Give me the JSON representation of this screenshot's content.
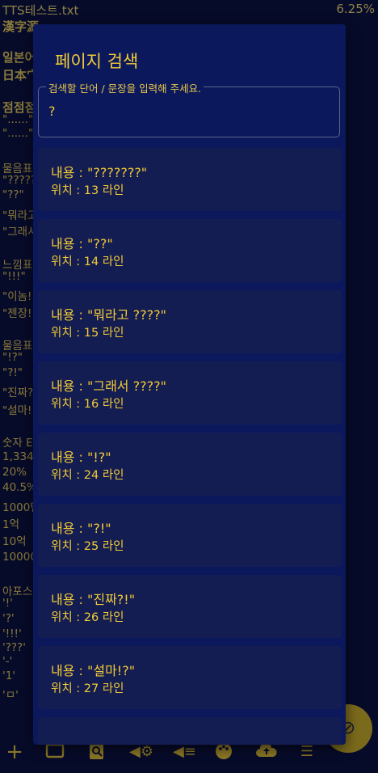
{
  "status_bar": {
    "file_name": "TTS테스트.txt",
    "progress": "6.25%"
  },
  "background_lines": [
    {
      "text": "漢字源",
      "bold": true
    },
    {
      "text": "일본어",
      "bold": true
    },
    {
      "text": "日本宀",
      "bold": true
    },
    {
      "text": "점점점",
      "bold": true
    },
    {
      "text": "\"......\""
    },
    {
      "text": "\"......\""
    },
    {
      "text": "물음표"
    },
    {
      "text": "\"?????"
    },
    {
      "text": "\"??\""
    },
    {
      "text": "\"뭐라고"
    },
    {
      "text": "\"그래서"
    },
    {
      "text": "느낌표"
    },
    {
      "text": "\"!!!\""
    },
    {
      "text": "\"이놈!"
    },
    {
      "text": "\"젠장!"
    },
    {
      "text": "물음표"
    },
    {
      "text": "\"!?\""
    },
    {
      "text": "\"?!\""
    },
    {
      "text": "\"진짜?"
    },
    {
      "text": "\"설마!"
    },
    {
      "text": "숫자 E"
    },
    {
      "text": "1,334"
    },
    {
      "text": "20%"
    },
    {
      "text": "40.5%"
    },
    {
      "text": "1000만"
    },
    {
      "text": "1억"
    },
    {
      "text": "10억"
    },
    {
      "text": "10000"
    },
    {
      "text": "아포스"
    },
    {
      "text": "'!'"
    },
    {
      "text": "'?'"
    },
    {
      "text": "'!!!'"
    },
    {
      "text": "'???'"
    },
    {
      "text": "'-'"
    },
    {
      "text": "'1'"
    },
    {
      "text": "'ㅁ'"
    }
  ],
  "dialog": {
    "title": "페이지 검색",
    "search_label": "검색할 단어 / 문장을 입력해 주세요.",
    "search_value": "?",
    "results": [
      {
        "content": "내용 : \"???????\"",
        "location": "위치 : 13 라인"
      },
      {
        "content": "내용 : \"??\"",
        "location": "위치 : 14 라인"
      },
      {
        "content": "내용 : \"뭐라고 ????\"",
        "location": "위치 : 15 라인"
      },
      {
        "content": "내용 : \"그래서 ????\"",
        "location": "위치 : 16 라인"
      },
      {
        "content": "내용 : \"!?\"",
        "location": "위치 : 24 라인"
      },
      {
        "content": "내용 : \"?!\"",
        "location": "위치 : 25 라인"
      },
      {
        "content": "내용 : \"진짜?!\"",
        "location": "위치 : 26 라인"
      },
      {
        "content": "내용 : \"설마!?\"",
        "location": "위치 : 27 라인"
      },
      {
        "content": "",
        "location": ""
      }
    ]
  },
  "toolbar": {
    "icons": [
      "add-icon",
      "folder-icon",
      "page-search-icon",
      "speaker-settings-icon",
      "speaker-filter-icon",
      "palette-icon",
      "cloud-upload-icon",
      "list-icon"
    ],
    "fab_icon": "tts-off-icon"
  },
  "colors": {
    "accent": "#f2cb36",
    "dialog_bg": "#0b185c",
    "card_bg": "#141d52",
    "page_bg": "#070b2a"
  }
}
